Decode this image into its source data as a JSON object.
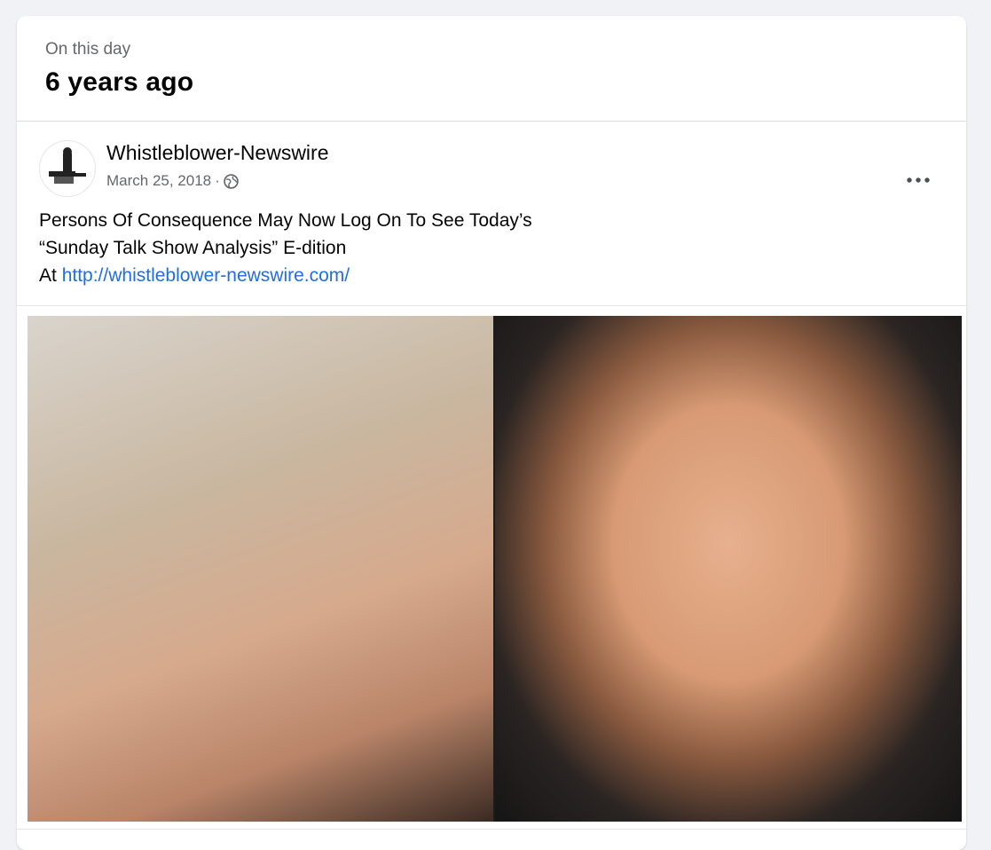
{
  "memory": {
    "kicker": "On this day",
    "title": "6 years ago"
  },
  "post": {
    "author": "Whistleblower-Newswire",
    "date": "March 25, 2018",
    "separator": "·",
    "privacy_icon": "globe-icon",
    "more_icon": "more-options-icon",
    "text_line1": "Persons Of Consequence May Now Log On To See Today’s",
    "text_line2": "“Sunday Talk Show Analysis” E-dition",
    "text_line3_prefix": "At ",
    "link": "http://whistleblower-newswire.com/"
  },
  "colors": {
    "background": "#f0f2f5",
    "card": "#ffffff",
    "primary_text": "#050505",
    "secondary_text": "#65676b",
    "link": "#216fdb"
  }
}
